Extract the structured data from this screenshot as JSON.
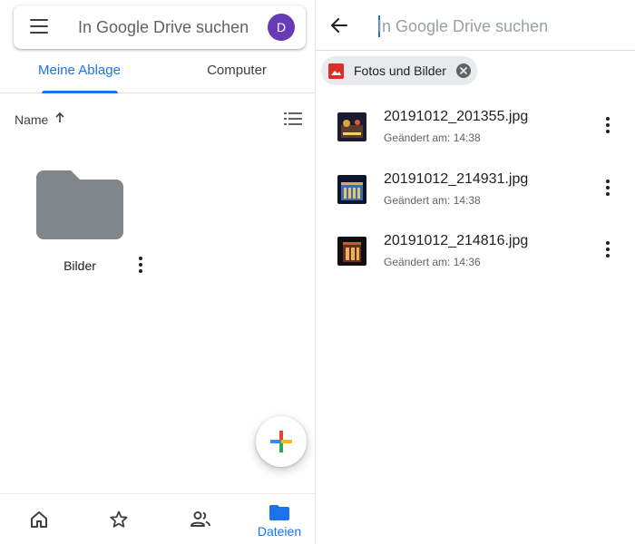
{
  "left": {
    "search": {
      "placeholder": "In Google Drive suchen",
      "avatar_initial": "D"
    },
    "tabs": [
      {
        "label": "Meine Ablage",
        "active": true
      },
      {
        "label": "Computer",
        "active": false
      }
    ],
    "sort": {
      "label": "Name",
      "direction": "ascending"
    },
    "folders": [
      {
        "name": "Bilder"
      }
    ],
    "bottom_nav": {
      "items": [
        {
          "icon": "home-icon",
          "label": ""
        },
        {
          "icon": "star-icon",
          "label": ""
        },
        {
          "icon": "shared-people-icon",
          "label": ""
        },
        {
          "icon": "folder-icon",
          "label": "Dateien",
          "active": true
        }
      ]
    }
  },
  "right": {
    "search_placeholder": "In Google Drive suchen",
    "filter_chip": {
      "label": "Fotos und Bilder",
      "icon": "image-icon"
    },
    "files": [
      {
        "name": "20191012_201355.jpg",
        "meta": "Geändert am: 14:38"
      },
      {
        "name": "20191012_214931.jpg",
        "meta": "Geändert am: 14:38"
      },
      {
        "name": "20191012_214816.jpg",
        "meta": "Geändert am: 14:36"
      }
    ]
  },
  "colors": {
    "accent": "#1a73e8",
    "avatar": "#673ab7",
    "folder": "#80868b",
    "chip_icon": "#d93025",
    "chip_bg": "#e8eaed"
  }
}
